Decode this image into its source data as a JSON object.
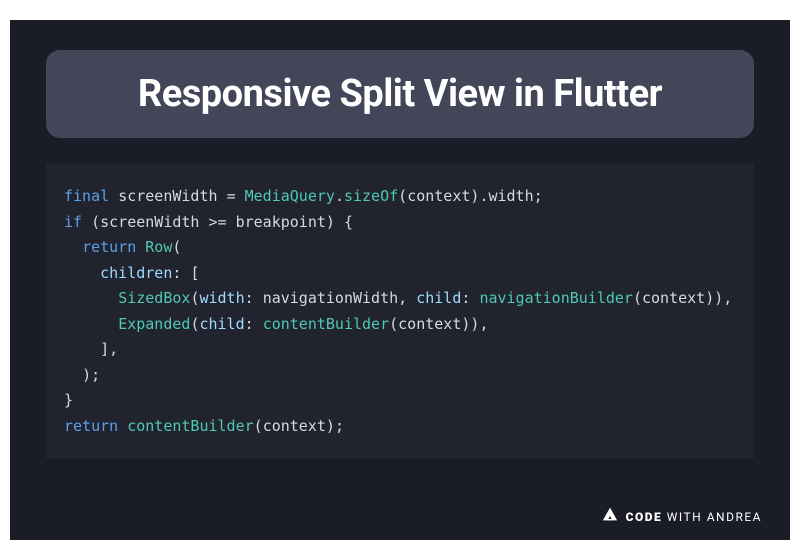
{
  "title": "Responsive Split View in Flutter",
  "code": {
    "tokens": [
      [
        [
          "final",
          "kw"
        ],
        [
          " ",
          "pun"
        ],
        [
          "screenWidth",
          "id"
        ],
        [
          " ",
          "pun"
        ],
        [
          "=",
          "op"
        ],
        [
          " ",
          "pun"
        ],
        [
          "MediaQuery",
          "fn"
        ],
        [
          ".",
          "pun"
        ],
        [
          "sizeOf",
          "fn"
        ],
        [
          "(",
          "pun"
        ],
        [
          "context",
          "id"
        ],
        [
          ")",
          "pun"
        ],
        [
          ".",
          "pun"
        ],
        [
          "width",
          "id"
        ],
        [
          ";",
          "pun"
        ]
      ],
      [
        [
          "if",
          "kw"
        ],
        [
          " ",
          "pun"
        ],
        [
          "(",
          "pun"
        ],
        [
          "screenWidth",
          "id"
        ],
        [
          " ",
          "pun"
        ],
        [
          ">=",
          "op"
        ],
        [
          " ",
          "pun"
        ],
        [
          "breakpoint",
          "id"
        ],
        [
          ")",
          "pun"
        ],
        [
          " ",
          "pun"
        ],
        [
          "{",
          "pun"
        ]
      ],
      [
        [
          "  ",
          "pun"
        ],
        [
          "return",
          "kw"
        ],
        [
          " ",
          "pun"
        ],
        [
          "Row",
          "fn"
        ],
        [
          "(",
          "pun"
        ]
      ],
      [
        [
          "    ",
          "pun"
        ],
        [
          "children",
          "prop"
        ],
        [
          ":",
          "pun"
        ],
        [
          " ",
          "pun"
        ],
        [
          "[",
          "pun"
        ]
      ],
      [
        [
          "      ",
          "pun"
        ],
        [
          "SizedBox",
          "fn"
        ],
        [
          "(",
          "pun"
        ],
        [
          "width",
          "prop"
        ],
        [
          ":",
          "pun"
        ],
        [
          " ",
          "pun"
        ],
        [
          "navigationWidth",
          "id"
        ],
        [
          ",",
          "pun"
        ],
        [
          " ",
          "pun"
        ],
        [
          "child",
          "prop"
        ],
        [
          ":",
          "pun"
        ],
        [
          " ",
          "pun"
        ],
        [
          "navigationBuilder",
          "fn"
        ],
        [
          "(",
          "pun"
        ],
        [
          "context",
          "id"
        ],
        [
          ")",
          "pun"
        ],
        [
          ")",
          "pun"
        ],
        [
          ",",
          "pun"
        ]
      ],
      [
        [
          "      ",
          "pun"
        ],
        [
          "Expanded",
          "fn"
        ],
        [
          "(",
          "pun"
        ],
        [
          "child",
          "prop"
        ],
        [
          ":",
          "pun"
        ],
        [
          " ",
          "pun"
        ],
        [
          "contentBuilder",
          "fn"
        ],
        [
          "(",
          "pun"
        ],
        [
          "context",
          "id"
        ],
        [
          ")",
          "pun"
        ],
        [
          ")",
          "pun"
        ],
        [
          ",",
          "pun"
        ]
      ],
      [
        [
          "    ",
          "pun"
        ],
        [
          "],",
          "pun"
        ]
      ],
      [
        [
          "  ",
          "pun"
        ],
        [
          ");",
          "pun"
        ]
      ],
      [
        [
          "}",
          "pun"
        ]
      ],
      [
        [
          "return",
          "kw"
        ],
        [
          " ",
          "pun"
        ],
        [
          "contentBuilder",
          "fn"
        ],
        [
          "(",
          "pun"
        ],
        [
          "context",
          "id"
        ],
        [
          ")",
          "pun"
        ],
        [
          ";",
          "pun"
        ]
      ]
    ]
  },
  "footer": {
    "brand_prefix": "CODE",
    "brand_suffix": "WITH ANDREA"
  }
}
